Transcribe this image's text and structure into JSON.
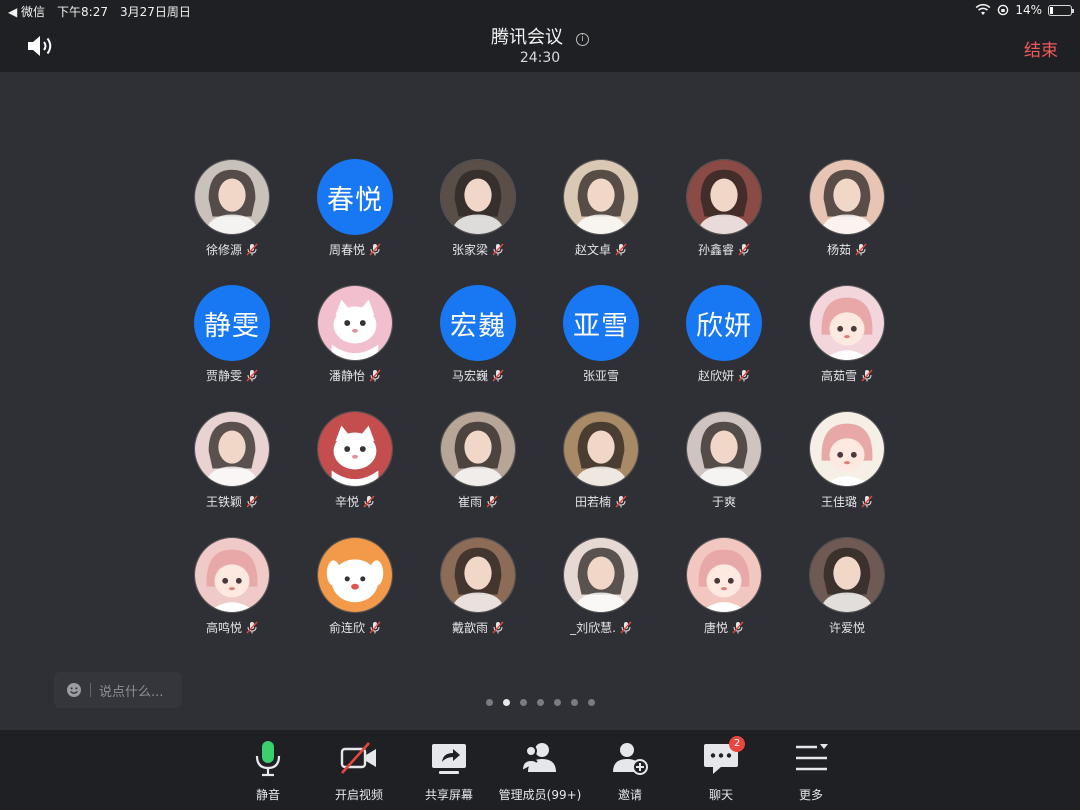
{
  "status_bar": {
    "back_app": "◀ 微信",
    "time": "下午8:27",
    "date": "3月27日周日",
    "battery_percent": "14%",
    "battery_level": 0.14
  },
  "header": {
    "title": "腾讯会议",
    "timer": "24:30",
    "end_label": "结束"
  },
  "colors": {
    "accent_blue": "#1877f2",
    "end_red": "#f15a5a",
    "mic_green": "#3ccf6e",
    "badge_red": "#e8463e"
  },
  "participants": [
    {
      "name": "徐修源",
      "avatar_text": "",
      "avatar": "photo-portrait-icon",
      "bg": "#c9c2bb",
      "muted": true
    },
    {
      "name": "周春悦",
      "avatar_text": "春悦",
      "avatar": "text",
      "bg": "#1877f2",
      "muted": true
    },
    {
      "name": "张家梁",
      "avatar_text": "",
      "avatar": "photo-portrait-icon",
      "bg": "#5a4f48",
      "muted": true
    },
    {
      "name": "赵文卓",
      "avatar_text": "",
      "avatar": "photo-portrait-icon",
      "bg": "#d9c8b3",
      "muted": true
    },
    {
      "name": "孙鑫睿",
      "avatar_text": "",
      "avatar": "photo-portrait-icon",
      "bg": "#8a4a45",
      "muted": true
    },
    {
      "name": "杨茹",
      "avatar_text": "",
      "avatar": "photo-portrait-icon",
      "bg": "#e7c4b4",
      "muted": true
    },
    {
      "name": "贾静雯",
      "avatar_text": "静雯",
      "avatar": "text",
      "bg": "#1877f2",
      "muted": true
    },
    {
      "name": "潘静怡",
      "avatar_text": "",
      "avatar": "cartoon-cat-icon",
      "bg": "#f2bfcf",
      "muted": true
    },
    {
      "name": "马宏巍",
      "avatar_text": "宏巍",
      "avatar": "text",
      "bg": "#1877f2",
      "muted": true
    },
    {
      "name": "张亚雪",
      "avatar_text": "亚雪",
      "avatar": "text",
      "bg": "#1877f2",
      "muted": false
    },
    {
      "name": "赵欣妍",
      "avatar_text": "欣妍",
      "avatar": "text",
      "bg": "#1877f2",
      "muted": true
    },
    {
      "name": "高茹雪",
      "avatar_text": "",
      "avatar": "cartoon-girl-icon",
      "bg": "#f3d6dc",
      "muted": true
    },
    {
      "name": "王铁颖",
      "avatar_text": "",
      "avatar": "photo-portrait-icon",
      "bg": "#e8d2d2",
      "muted": true
    },
    {
      "name": "辛悦",
      "avatar_text": "",
      "avatar": "cartoon-cat-icon",
      "bg": "#c44d4d",
      "muted": true
    },
    {
      "name": "崔雨",
      "avatar_text": "",
      "avatar": "photo-portrait-icon",
      "bg": "#b7a597",
      "muted": true
    },
    {
      "name": "田若楠",
      "avatar_text": "",
      "avatar": "photo-portrait-icon",
      "bg": "#a98a66",
      "muted": true
    },
    {
      "name": "于爽",
      "avatar_text": "",
      "avatar": "photo-portrait-icon",
      "bg": "#cfc4c0",
      "muted": false
    },
    {
      "name": "王佳璐",
      "avatar_text": "",
      "avatar": "cartoon-girl-icon",
      "bg": "#f6efe6",
      "muted": true
    },
    {
      "name": "高鸣悦",
      "avatar_text": "",
      "avatar": "cartoon-girl-icon",
      "bg": "#f0c9c9",
      "muted": true
    },
    {
      "name": "俞连欣",
      "avatar_text": "",
      "avatar": "cartoon-dog-icon",
      "bg": "#f29a4a",
      "muted": true
    },
    {
      "name": "戴歆雨",
      "avatar_text": "",
      "avatar": "photo-portrait-icon",
      "bg": "#8c6b57",
      "muted": true
    },
    {
      "name": "_刘欣慧.",
      "avatar_text": "",
      "avatar": "photo-portrait-icon",
      "bg": "#e6d9d4",
      "muted": true
    },
    {
      "name": "唐悦",
      "avatar_text": "",
      "avatar": "cartoon-girl-icon",
      "bg": "#f2c7c0",
      "muted": true
    },
    {
      "name": "许爱悦",
      "avatar_text": "",
      "avatar": "photo-portrait-icon",
      "bg": "#6e5a52",
      "muted": false
    }
  ],
  "chat": {
    "placeholder": "说点什么..."
  },
  "pager": {
    "total": 7,
    "current": 2
  },
  "toolbar": {
    "mute_label": "静音",
    "video_label": "开启视频",
    "share_label": "共享屏幕",
    "members_label": "管理成员(99+)",
    "invite_label": "邀请",
    "chat_label": "聊天",
    "chat_badge": "2",
    "more_label": "更多"
  }
}
